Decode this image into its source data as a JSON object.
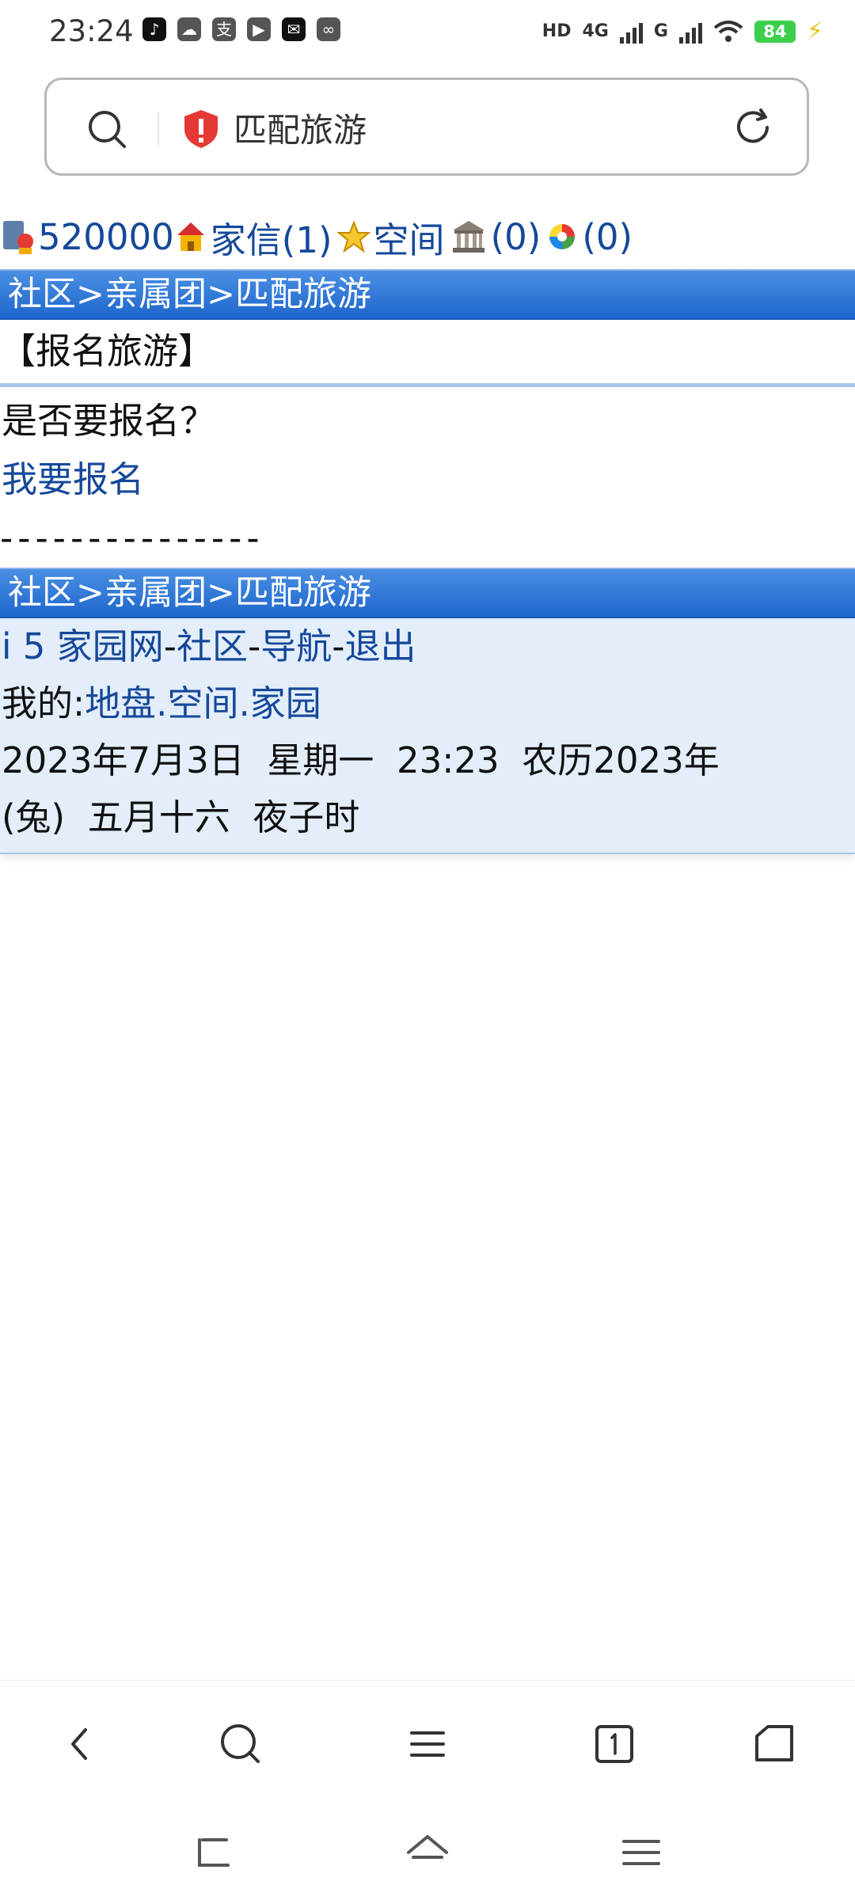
{
  "status_bar": {
    "time": "23:24",
    "apps": [
      "tiktok-icon",
      "cloud-icon",
      "alipay-icon",
      "game-icon",
      "mail-icon",
      "link-icon"
    ],
    "net_hd": "HD",
    "net_4g": "4G",
    "net_g": "G",
    "battery": "84"
  },
  "url_bar": {
    "title": "匹配旅游"
  },
  "page": {
    "userbar": {
      "id": "520000",
      "mail": "家信(1)",
      "space": "空间",
      "count1": "(0)",
      "count2": "(0)"
    },
    "breadcrumb_top": "社区>亲属团>匹配旅游",
    "section_title": "【报名旅游】",
    "question": "是否要报名？",
    "signup_link": "我要报名",
    "dashes": "---------------",
    "breadcrumb_bottom": "社区>亲属团>匹配旅游",
    "footer": {
      "site": "i 5 家园网",
      "sep1": "-",
      "community": "社区",
      "sep2": "-",
      "nav": "导航",
      "sep3": "-",
      "logout": "退出",
      "mine_label": "我的:",
      "mine_links": "地盘.空间.家园",
      "date_line1": "2023年7月3日  星期一  23:23  农历2023年",
      "date_line2": "(兔)  五月十六  夜子时"
    }
  },
  "colors": {
    "link": "#15489a",
    "bar_blue": "#2b72d4",
    "footer_bg": "#e3eefa"
  }
}
